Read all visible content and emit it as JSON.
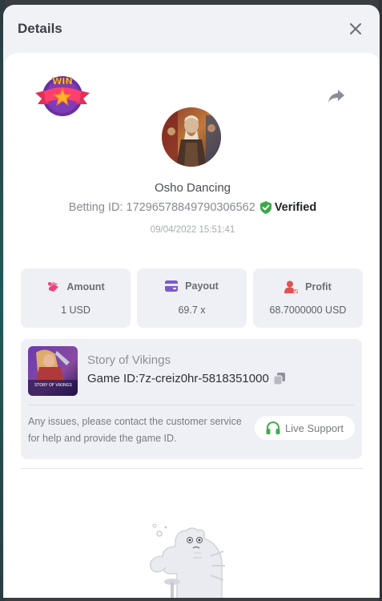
{
  "modal": {
    "title": "Details"
  },
  "bet": {
    "game_name": "Osho Dancing",
    "betting_id_label": "Betting ID: 17296578849790306562",
    "verified_label": "Verified",
    "timestamp": "09/04/2022 15:51:41",
    "win_badge_text": "WIN"
  },
  "stats": {
    "amount": {
      "label": "Amount",
      "value": "1 USD"
    },
    "payout": {
      "label": "Payout",
      "value": "69.7 x"
    },
    "profit": {
      "label": "Profit",
      "value": "68.7000000 USD"
    }
  },
  "game": {
    "title": "Story of Vikings",
    "game_id": "Game ID:7z-creiz0hr-5818351000",
    "thumb_caption": "STORY OF VIKINGS"
  },
  "support": {
    "message": "Any issues, please contact the customer service for help and provide the game ID.",
    "button_label": "Live Support"
  },
  "colors": {
    "verified_green": "#3fa84a",
    "amount_icon": "#e8457a",
    "payout_icon": "#7b5bc9",
    "profit_icon": "#e05252",
    "support_icon": "#3fae49"
  },
  "icons": {
    "close": "close-icon",
    "share": "share-icon",
    "verified": "shield-check-icon",
    "amount": "coins-icon",
    "payout": "wallet-icon",
    "profit": "user-profit-icon",
    "copy": "copy-icon",
    "support": "headset-icon"
  }
}
